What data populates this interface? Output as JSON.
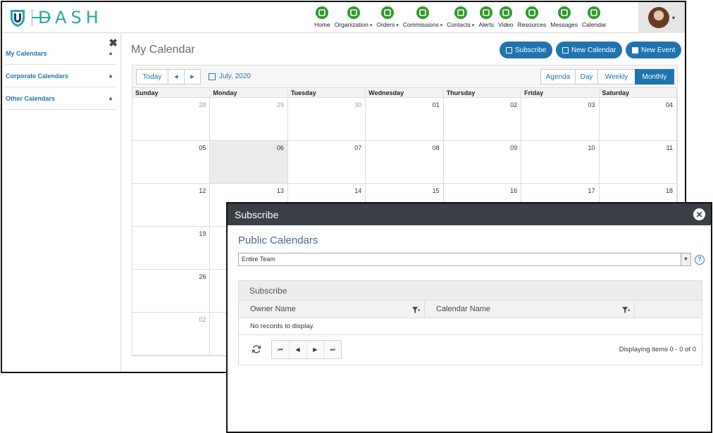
{
  "app": {
    "logo_text": "DASH",
    "nav": [
      {
        "label": "Home",
        "icon": "home-grid-icon",
        "dropdown": false
      },
      {
        "label": "Organization",
        "icon": "organization-icon",
        "dropdown": true
      },
      {
        "label": "Orders",
        "icon": "orders-icon",
        "dropdown": true
      },
      {
        "label": "Commissions",
        "icon": "commissions-icon",
        "dropdown": true
      },
      {
        "label": "Contacts",
        "icon": "contacts-icon",
        "dropdown": true
      },
      {
        "label": "Alerts",
        "icon": "bell-icon",
        "dropdown": false
      },
      {
        "label": "Video",
        "icon": "video-icon",
        "dropdown": false
      },
      {
        "label": "Resources",
        "icon": "resources-icon",
        "dropdown": false
      },
      {
        "label": "Messages",
        "icon": "envelope-icon",
        "dropdown": false
      },
      {
        "label": "Calendar",
        "icon": "calendar-icon",
        "dropdown": false
      }
    ],
    "nav_color": "#2e9a2a",
    "accent": "#1f73ae"
  },
  "sidebar": {
    "items": [
      {
        "label": "My Calendars"
      },
      {
        "label": "Corporate Calendars"
      },
      {
        "label": "Other Calendars"
      }
    ]
  },
  "calendar": {
    "title": "My Calendar",
    "buttons": {
      "subscribe": "Subscribe",
      "new_calendar": "New Calendar",
      "new_event": "New Event"
    },
    "today_label": "Today",
    "month_label": "July, 2020",
    "views": [
      "Agenda",
      "Day",
      "Weekly",
      "Monthly"
    ],
    "active_view": "Monthly",
    "day_headers": [
      "Sunday",
      "Monday",
      "Tuesday",
      "Wednesday",
      "Thursday",
      "Friday",
      "Saturday"
    ],
    "weeks": [
      [
        "28",
        "29",
        "30",
        "01",
        "02",
        "03",
        "04"
      ],
      [
        "05",
        "06",
        "07",
        "08",
        "09",
        "10",
        "11"
      ],
      [
        "12",
        "13",
        "14",
        "15",
        "16",
        "17",
        "18"
      ],
      [
        "19",
        "",
        "",
        "",
        "",
        "",
        ""
      ],
      [
        "26",
        "",
        "",
        "",
        "",
        "",
        ""
      ],
      [
        "02",
        "",
        "",
        "",
        "",
        "",
        ""
      ]
    ],
    "muted_cells": [
      "0-0",
      "0-1",
      "0-2",
      "5-0"
    ],
    "today_cell": "1-1"
  },
  "dialog": {
    "title": "Subscribe",
    "section_title": "Public Calendars",
    "select_value": "Entire Team",
    "panel_title": "Subscribe",
    "columns": [
      "Owner Name",
      "Calendar Name"
    ],
    "empty_text": "No records to display.",
    "pager_info": "Displaying items 0 - 0 of 0"
  }
}
